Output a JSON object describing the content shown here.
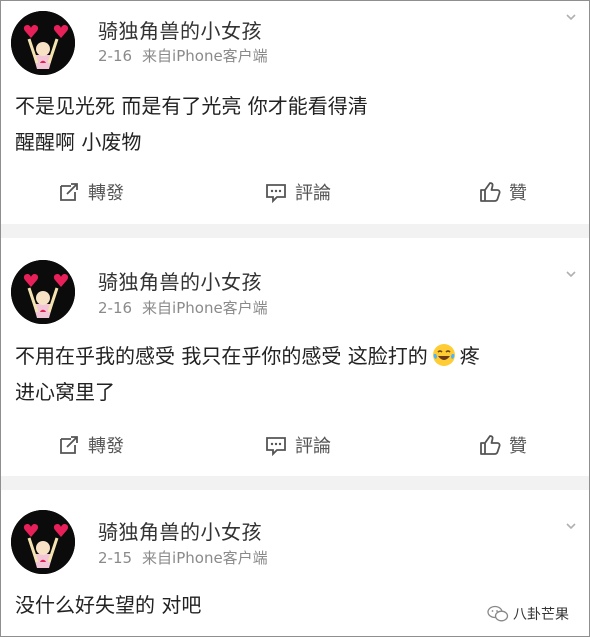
{
  "posts": [
    {
      "username": "骑独角兽的小女孩",
      "date": "2-16",
      "source": "来自iPhone客户端",
      "content_lines": [
        "不是见光死 而是有了光亮 你才能看得清",
        "醒醒啊 小废物"
      ],
      "actions": {
        "repost": "轉發",
        "comment": "評論",
        "like": "贊"
      }
    },
    {
      "username": "骑独角兽的小女孩",
      "date": "2-16",
      "source": "来自iPhone客户端",
      "content_before_emoji": "不用在乎我的感受 我只在乎你的感受 这脸打的",
      "content_after_emoji": "疼",
      "content_line2": "进心窝里了",
      "emoji": "laughing-tears-emoji",
      "actions": {
        "repost": "轉發",
        "comment": "評論",
        "like": "贊"
      }
    },
    {
      "username": "骑独角兽的小女孩",
      "date": "2-15",
      "source": "来自iPhone客户端",
      "content_lines": [
        "没什么好失望的 对吧"
      ]
    }
  ],
  "watermark": {
    "text": "八卦芒果",
    "icon": "wechat-icon"
  },
  "colors": {
    "name": "#333333",
    "meta": "#8a8a8a",
    "divider": "#f2f2f2",
    "border": "#8f8f8f"
  }
}
